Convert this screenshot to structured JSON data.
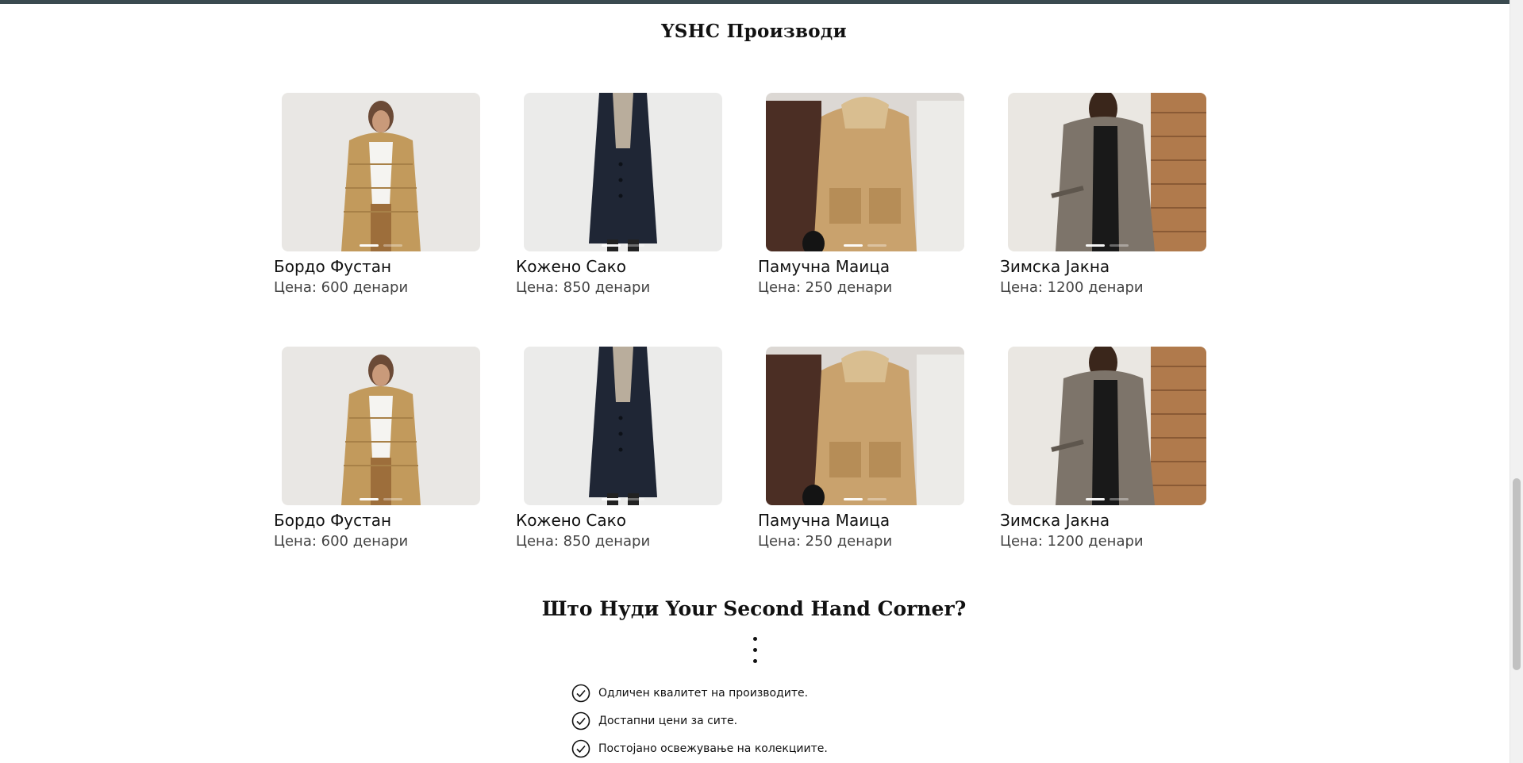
{
  "products_section": {
    "title": "YSHC Производи"
  },
  "products": [
    {
      "name": "Бордо Фустан",
      "price": "Цена: 600 денари",
      "image": "beige-puffer-coat-photo"
    },
    {
      "name": "Кожено Сако",
      "price": "Цена: 850 денари",
      "image": "navy-long-coat-photo"
    },
    {
      "name": "Памучна Маица",
      "price": "Цена: 250 денари",
      "image": "camel-puffer-jacket-photo"
    },
    {
      "name": "Зимска Јакна",
      "price": "Цена: 1200 денари",
      "image": "plaid-trench-coat-photo"
    },
    {
      "name": "Бордо Фустан",
      "price": "Цена: 600 денари",
      "image": "beige-puffer-coat-photo"
    },
    {
      "name": "Кожено Сако",
      "price": "Цена: 850 денари",
      "image": "navy-long-coat-photo"
    },
    {
      "name": "Памучна Маица",
      "price": "Цена: 250 денари",
      "image": "camel-puffer-jacket-photo"
    },
    {
      "name": "Зимска Јакна",
      "price": "Цена: 1200 денари",
      "image": "plaid-trench-coat-photo"
    }
  ],
  "offer_section": {
    "title": "Што Нуди Your Second Hand Corner?",
    "features": [
      "Одличен квалитет на производите.",
      "Достапни цени за сите.",
      "Постојано освежување на колекциите."
    ]
  },
  "colors": {
    "top_bar": "#3a4a50",
    "text": "#111111",
    "price_text": "#444444"
  },
  "icons": {
    "feature_bullet": "check-circle-icon",
    "divider": "vertical-dots-icon"
  }
}
